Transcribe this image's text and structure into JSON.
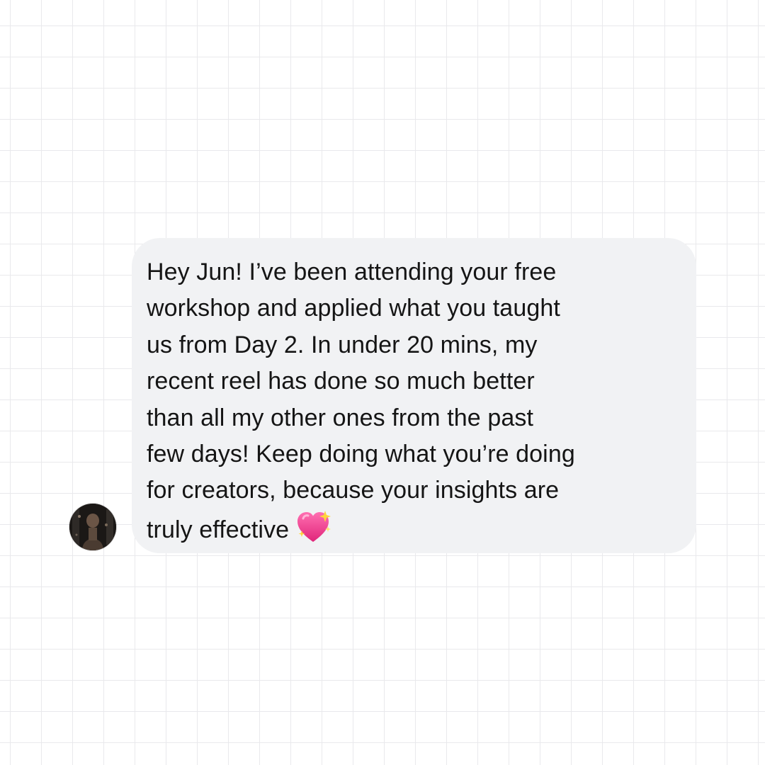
{
  "conversation": {
    "sender": {
      "avatar_icon": "profile-photo"
    },
    "message": {
      "lines": [
        "Hey Jun! I’ve been attending your free",
        "workshop and applied what you taught",
        "us from Day 2. In under 20 mins, my",
        "recent reel has done so much better",
        "than all my other ones from the past",
        "few days! Keep doing what you’re doing",
        "for creators, because your insights are",
        "truly effective"
      ],
      "emoji": "sparkling-heart-icon"
    }
  },
  "colors": {
    "page_background": "#ffffff",
    "grid_line": "#e9e9ec",
    "bubble_background": "#f1f2f4",
    "text": "#151515",
    "heart": "#ec3f8c"
  }
}
